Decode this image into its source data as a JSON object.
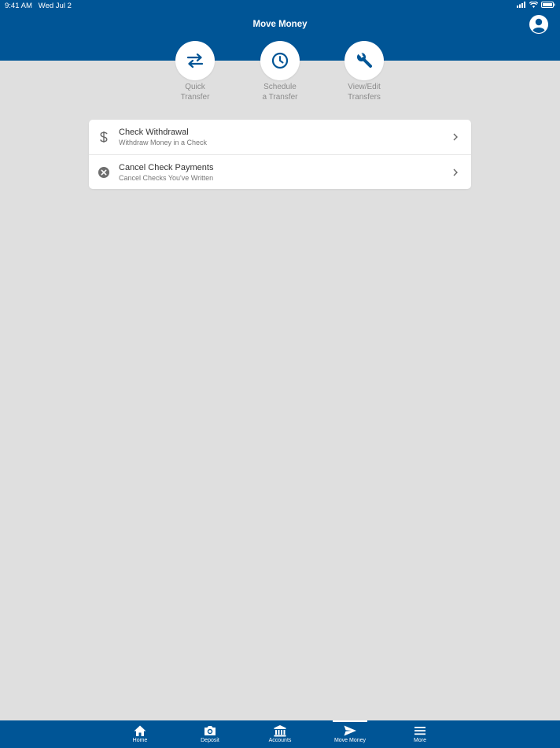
{
  "status_bar": {
    "time": "9:41 AM",
    "date": "Wed Jul 2"
  },
  "header": {
    "title": "Move Money",
    "profile_icon": "person-circle-icon"
  },
  "actions": [
    {
      "line1": "Quick",
      "line2": "Transfer",
      "icon": "swap-arrows-icon"
    },
    {
      "line1": "Schedule",
      "line2": "a Transfer",
      "icon": "clock-icon"
    },
    {
      "line1": "View/Edit",
      "line2": "Transfers",
      "icon": "wrench-icon"
    }
  ],
  "list": [
    {
      "title": "Check Withdrawal",
      "subtitle": "Withdraw Money in a Check",
      "icon": "dollar-icon"
    },
    {
      "title": "Cancel Check Payments",
      "subtitle": "Cancel Checks You've Written",
      "icon": "cancel-circle-icon"
    }
  ],
  "tabs": [
    {
      "label": "Home",
      "icon": "home-icon"
    },
    {
      "label": "Deposit",
      "icon": "camera-icon"
    },
    {
      "label": "Accounts",
      "icon": "bank-icon"
    },
    {
      "label": "Move Money",
      "icon": "send-icon",
      "active": true
    },
    {
      "label": "More",
      "icon": "menu-icon"
    }
  ],
  "colors": {
    "primary": "#005596",
    "background": "#dfdfdf",
    "muted_text": "#8c8c8c"
  }
}
